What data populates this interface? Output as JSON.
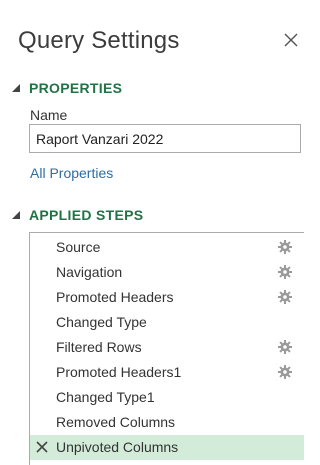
{
  "pane": {
    "title": "Query Settings",
    "close_icon": "close-icon"
  },
  "properties": {
    "heading": "PROPERTIES",
    "name_label": "Name",
    "name_value": "Raport Vanzari 2022",
    "all_properties_link": "All Properties"
  },
  "applied_steps": {
    "heading": "APPLIED STEPS",
    "steps": [
      {
        "label": "Source",
        "has_settings": true
      },
      {
        "label": "Navigation",
        "has_settings": true
      },
      {
        "label": "Promoted Headers",
        "has_settings": true
      },
      {
        "label": "Changed Type",
        "has_settings": false
      },
      {
        "label": "Filtered Rows",
        "has_settings": true
      },
      {
        "label": "Promoted Headers1",
        "has_settings": true
      },
      {
        "label": "Changed Type1",
        "has_settings": false
      },
      {
        "label": "Removed Columns",
        "has_settings": false
      },
      {
        "label": "Unpivoted Columns",
        "has_settings": false,
        "selected": true
      }
    ]
  },
  "colors": {
    "accent": "#217346",
    "link": "#2e6da4",
    "selected_row": "#d3ecd9"
  }
}
